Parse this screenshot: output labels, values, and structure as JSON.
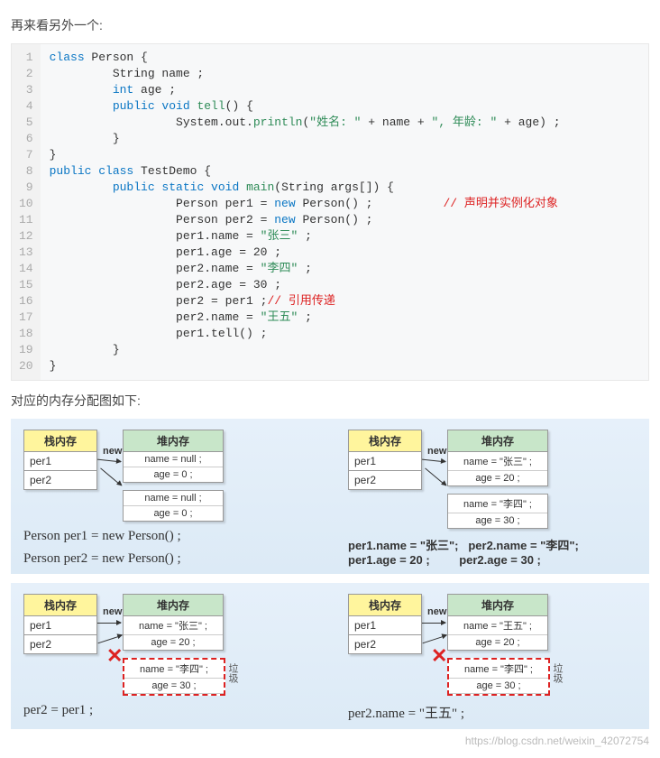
{
  "intro": "再来看另外一个:",
  "code": {
    "gutter": "1\n2\n3\n4\n5\n6\n7\n8\n9\n10\n11\n12\n13\n14\n15\n16\n17\n18\n19\n20",
    "tokens": {
      "l1_kw": "class",
      "l1_rest": " Person {",
      "l2": "         String name ;",
      "l3_kw": "int",
      "l3_rest": " age ;",
      "l4_kw": "public void ",
      "l4_fn": "tell",
      "l4_rest": "() {",
      "l5a": "                  System.out.",
      "l5_fn": "println",
      "l5_b": "(",
      "l5_s1": "\"姓名: \"",
      "l5_c": " + name + ",
      "l5_s2": "\", 年龄: \"",
      "l5_d": " + age) ;",
      "l6": "         }",
      "l7": "}",
      "l8_kw": "public class ",
      "l8_rest": "TestDemo {",
      "l9_kw": "public static void ",
      "l9_fn": "main",
      "l9_rest": "(String args[]) {",
      "l10a": "                  Person per1 = ",
      "l10_kw": "new",
      "l10b": " Person() ;          ",
      "l10_cmt": "// 声明并实例化对象",
      "l11a": "                  Person per2 = ",
      "l11_kw": "new",
      "l11b": " Person() ;",
      "l12a": "                  per1.name = ",
      "l12_s": "\"张三\"",
      "l12b": " ;",
      "l13": "                  per1.age = 20 ;",
      "l14a": "                  per2.name = ",
      "l14_s": "\"李四\"",
      "l14b": " ;",
      "l15": "                  per2.age = 30 ;",
      "l16a": "                  per2 = per1 ;",
      "l16_cmt": "// 引用传递",
      "l17a": "                  per2.name = ",
      "l17_s": "\"王五\"",
      "l17b": " ;",
      "l18": "                  per1.tell() ;",
      "l19": "         }",
      "l20": "}"
    }
  },
  "mid_para": "对应的内存分配图如下:",
  "diagrams": {
    "stack_hdr": "栈内存",
    "heap_hdr": "堆内存",
    "per1": "per1",
    "per2": "per2",
    "new": "new",
    "garbage": "垃圾",
    "d1": {
      "heap_name": "name = null ;",
      "heap_age": "age = 0 ;",
      "caption1": "Person per1 = new Person() ;",
      "caption2": "Person per2 = new Person() ;"
    },
    "d2": {
      "h1_name": "name = \"张三\" ;",
      "h1_age": "age = 20 ;",
      "h2_name": "name = \"李四\" ;",
      "h2_age": "age = 30 ;",
      "cap": "per1.name = \"张三\";   per2.name = \"李四\";\nper1.age = 20 ;         per2.age = 30 ;"
    },
    "d3": {
      "h1_name": "name = \"张三\" ;",
      "h1_age": "age = 20 ;",
      "h2_name": "name = \"李四\" ;",
      "h2_age": "age = 30 ;",
      "cap": "per2 = per1 ;"
    },
    "d4": {
      "h1_name": "name = \"王五\" ;",
      "h1_age": "age = 20 ;",
      "h2_name": "name = \"李四\" ;",
      "h2_age": "age = 30 ;",
      "cap": "per2.name = \"王五\" ;"
    }
  },
  "watermark": "https://blog.csdn.net/weixin_42072754"
}
